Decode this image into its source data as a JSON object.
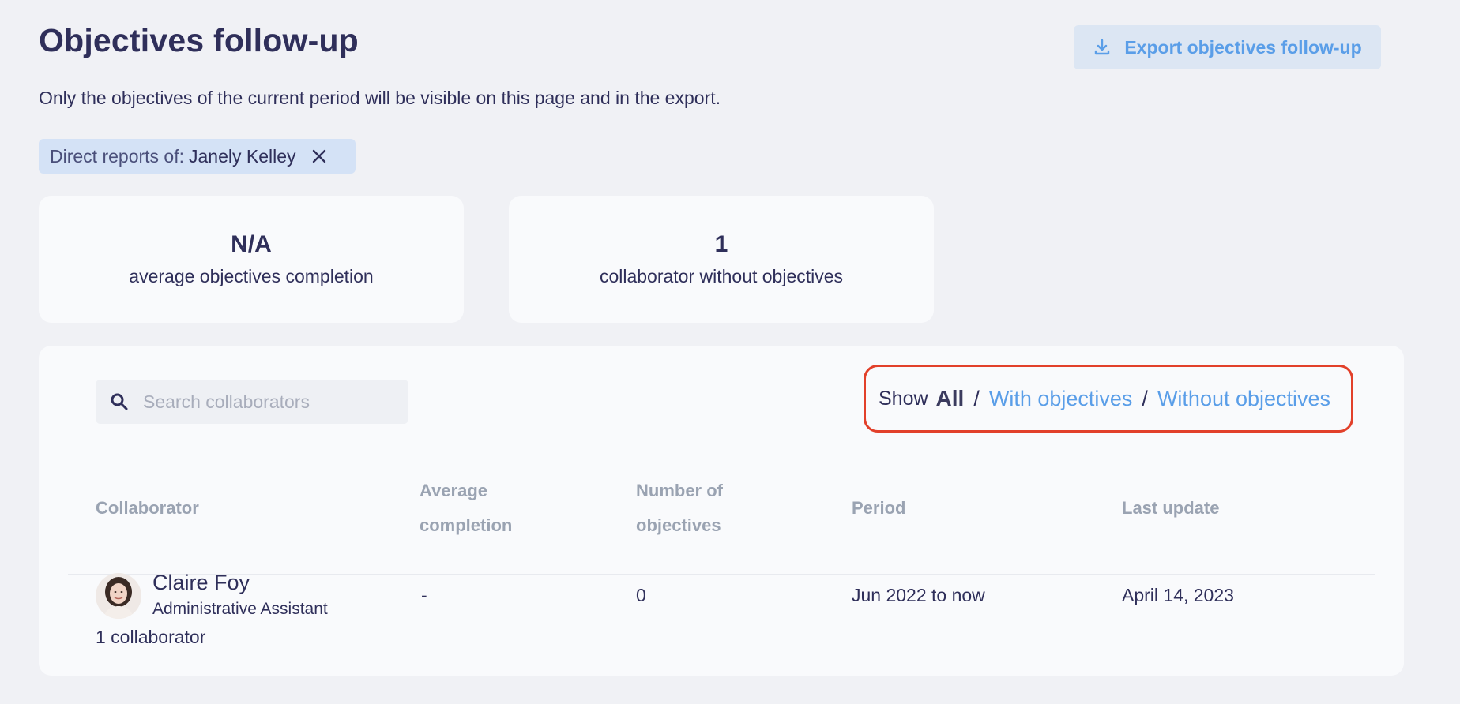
{
  "header": {
    "title": "Objectives follow-up",
    "export_label": "Export objectives follow-up",
    "subtitle": "Only the objectives of the current period will be visible on this page and in the export."
  },
  "filter": {
    "prefix": "Direct reports of:",
    "value": "Janely Kelley"
  },
  "stats": [
    {
      "value": "N/A",
      "label": "average objectives completion"
    },
    {
      "value": "1",
      "label": "collaborator without objectives"
    }
  ],
  "search": {
    "placeholder": "Search collaborators"
  },
  "show": {
    "label": "Show",
    "all": "All",
    "separator": "/",
    "with": "With objectives",
    "without": "Without objectives",
    "selected": "All"
  },
  "table": {
    "headers": {
      "collaborator": "Collaborator",
      "average_completion": "Average completion",
      "number_of_objectives": "Number of objectives",
      "period": "Period",
      "last_update": "Last update"
    },
    "rows": [
      {
        "name": "Claire Foy",
        "role": "Administrative Assistant",
        "average_completion": "-",
        "number_of_objectives": "0",
        "period": "Jun 2022 to now",
        "last_update": "April 14, 2023"
      }
    ],
    "count_label": "1 collaborator"
  },
  "colors": {
    "accent": "#5a9ee8",
    "highlight_border": "#e2402a",
    "background": "#f0f1f5"
  }
}
